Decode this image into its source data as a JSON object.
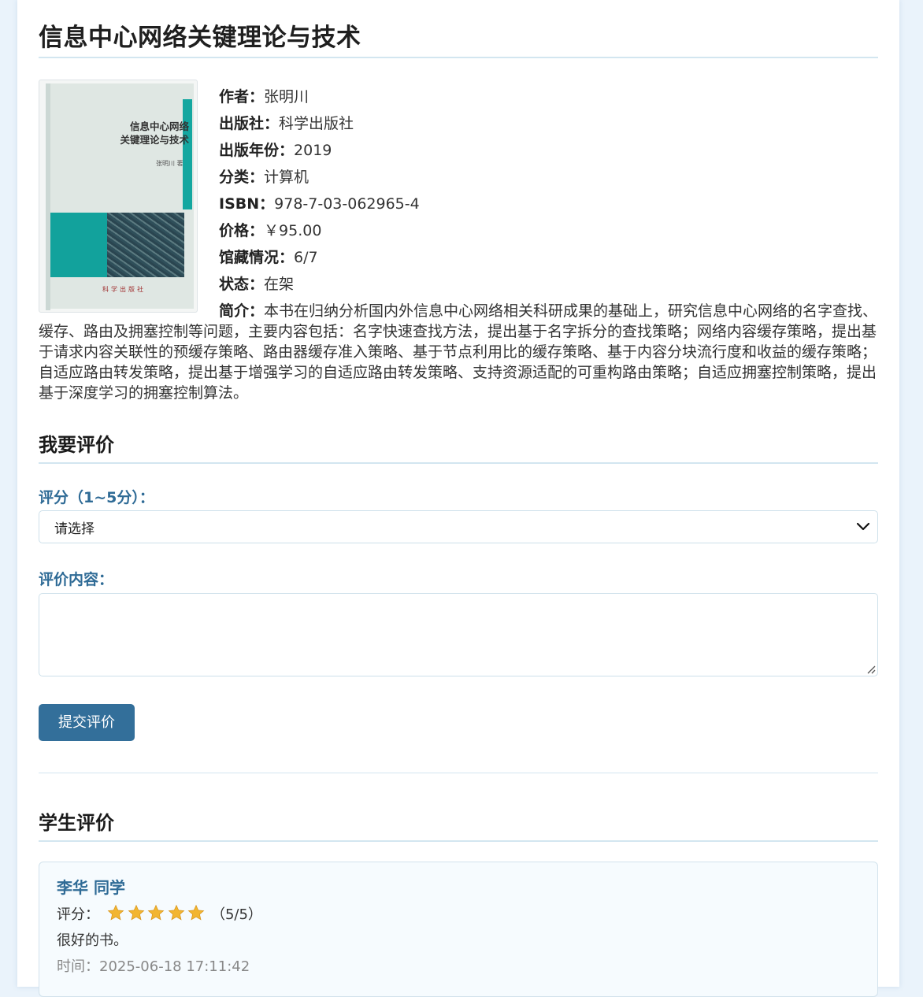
{
  "book": {
    "title": "信息中心网络关键理论与技术",
    "cover": {
      "title_line1": "信息中心网络",
      "title_line2": "关键理论与技术",
      "author": "张明川 著",
      "publisher": "科学出版社"
    },
    "fields": [
      {
        "key": "作者：",
        "value": "张明川"
      },
      {
        "key": "出版社：",
        "value": "科学出版社"
      },
      {
        "key": "出版年份：",
        "value": "2019"
      },
      {
        "key": "分类：",
        "value": "计算机"
      },
      {
        "key": "ISBN：",
        "value": "978-7-03-062965-4"
      },
      {
        "key": "价格：",
        "value": "￥95.00"
      },
      {
        "key": "馆藏情况：",
        "value": "6/7"
      },
      {
        "key": "状态：",
        "value": "在架"
      }
    ],
    "summary_label": "简介：",
    "summary": "本书在归纳分析国内外信息中心网络相关科研成果的基础上，研究信息中心网络的名字查找、缓存、路由及拥塞控制等问题，主要内容包括：名字快速查找方法，提出基于名字拆分的查找策略；网络内容缓存策略，提出基于请求内容关联性的预缓存策略、路由器缓存准入策略、基于节点利用比的缓存策略、基于内容分块流行度和收益的缓存策略；自适应路由转发策略，提出基于增强学习的自适应路由转发策略、支持资源适配的可重构路由策略；自适应拥塞控制策略，提出基于深度学习的拥塞控制算法。"
  },
  "review_form": {
    "heading": "我要评价",
    "rating_label": "评分（1~5分）：",
    "rating_selected": "请选择",
    "content_label": "评价内容：",
    "content_value": "",
    "submit_label": "提交评价"
  },
  "reviews": {
    "heading": "学生评价",
    "items": [
      {
        "name": "李华 同学",
        "score_label": "评分：",
        "stars": 5,
        "score_text": "（5/5）",
        "text": "很好的书。",
        "time": "时间：2025-06-18 17:11:42"
      }
    ]
  },
  "colors": {
    "accent": "#336f9a",
    "label": "#2f6b96",
    "star": "#f2b531",
    "rule": "#d3e6f0"
  }
}
